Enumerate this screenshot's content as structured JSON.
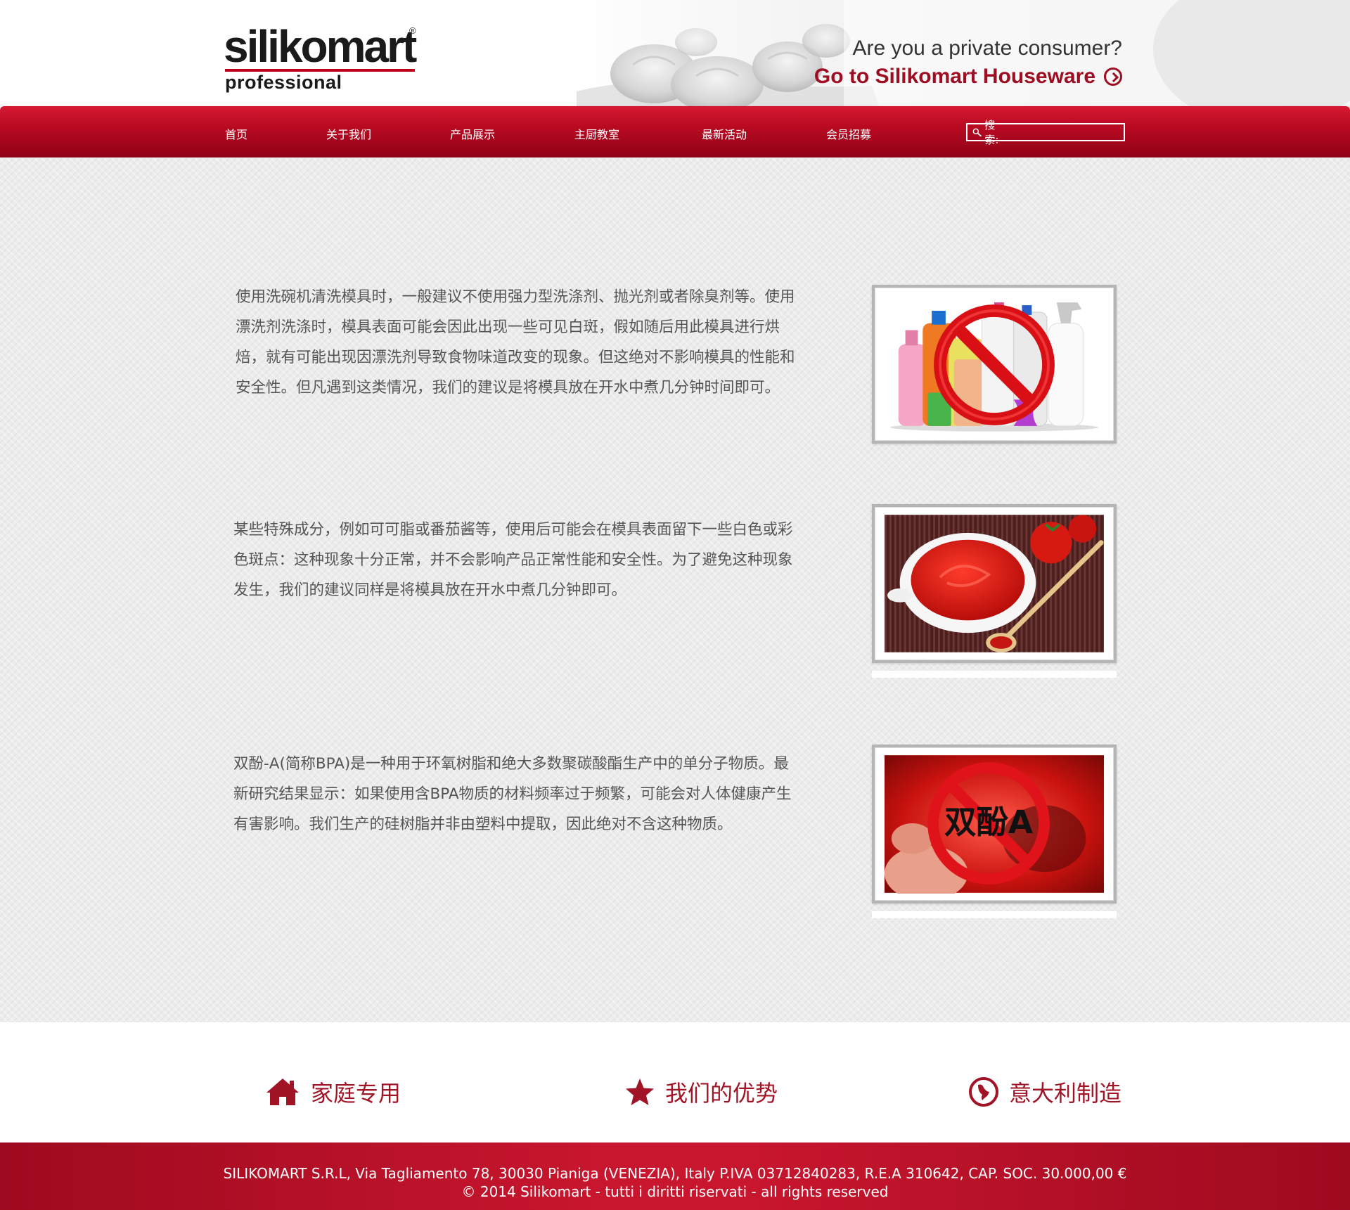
{
  "header": {
    "logo": {
      "main": "silikomart",
      "registered": "®",
      "sub": "professional"
    },
    "consumer_question": "Are you a private consumer?",
    "houseware_link": "Go to Silikomart Houseware"
  },
  "nav": {
    "items": [
      "首页",
      "关于我们",
      "产品展示",
      "主厨教室",
      "最新活动",
      "会员招募"
    ],
    "search_label": "搜索:",
    "search_value": ""
  },
  "sections": [
    {
      "text": "使用洗碗机清洗模具时，一般建议不使用强力型洗涤剂、抛光剂或者除臭剂等。使用漂洗剂洗涤时，模具表面可能会因此出现一些可见白斑，假如随后用此模具进行烘焙，就有可能出现因漂洗剂导致食物味道改变的现象。但这绝对不影响模具的性能和安全性。但凡遇到这类情况，我们的建议是将模具放在开水中煮几分钟时间即可。",
      "image": "no-detergents-icon"
    },
    {
      "text": "某些特殊成分，例如可可脂或番茄酱等，使用后可能会在模具表面留下一些白色或彩色斑点：这种现象十分正常，并不会影响产品正常性能和安全性。为了避免这种现象发生，我们的建议同样是将模具放在开水中煮几分钟即可。",
      "image": "tomato-sauce-photo"
    },
    {
      "text": "双酚-A(简称BPA)是一种用于环氧树脂和绝大多数聚碳酸酯生产中的单分子物质。最新研究结果显示：如果使用含BPA物质的材料频率过于频繁，可能会对人体健康产生有害影响。我们生产的硅树脂并非由塑料中提取，因此绝对不含这种物质。",
      "image": "no-bpa-photo",
      "image_text": "双酚A"
    }
  ],
  "features": [
    {
      "label": "家庭专用",
      "icon": "house-icon"
    },
    {
      "label": "我们的优势",
      "icon": "star-icon"
    },
    {
      "label": "意大利制造",
      "icon": "italy-badge-icon"
    }
  ],
  "footer": {
    "line1": "SILIKOMART S.R.L, Via Tagliamento 78, 30030 Pianiga (VENEZIA), Italy P.IVA 03712840283, R.E.A 310642, CAP. SOC. 30.000,00 €",
    "line2": "© 2014 Silikomart - tutti i diritti riservati - all rights reserved"
  },
  "colors": {
    "brand_red": "#b80a22",
    "accent_dark_red": "#9e0e22",
    "body_text": "#555555",
    "background": "#ececec"
  }
}
